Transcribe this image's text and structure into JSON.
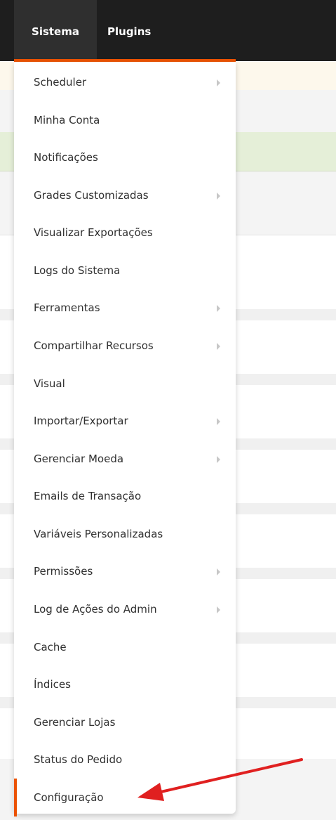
{
  "topnav": {
    "tabs": [
      {
        "label": "Sistema",
        "active": true
      },
      {
        "label": "Plugins",
        "active": false
      }
    ]
  },
  "menu": {
    "items": [
      {
        "label": "Scheduler",
        "submenu": true
      },
      {
        "label": "Minha Conta",
        "submenu": false
      },
      {
        "label": "Notificações",
        "submenu": false
      },
      {
        "label": "Grades Customizadas",
        "submenu": true
      },
      {
        "label": "Visualizar Exportações",
        "submenu": false
      },
      {
        "label": "Logs do Sistema",
        "submenu": false
      },
      {
        "label": "Ferramentas",
        "submenu": true
      },
      {
        "label": "Compartilhar Recursos",
        "submenu": true
      },
      {
        "label": "Visual",
        "submenu": false
      },
      {
        "label": "Importar/Exportar",
        "submenu": true
      },
      {
        "label": "Gerenciar Moeda",
        "submenu": true
      },
      {
        "label": "Emails de Transação",
        "submenu": false
      },
      {
        "label": "Variáveis Personalizadas",
        "submenu": false
      },
      {
        "label": "Permissões",
        "submenu": true
      },
      {
        "label": "Log de Ações do Admin",
        "submenu": true
      },
      {
        "label": "Cache",
        "submenu": false
      },
      {
        "label": "Índices",
        "submenu": false
      },
      {
        "label": "Gerenciar Lojas",
        "submenu": false
      },
      {
        "label": "Status do Pedido",
        "submenu": false
      },
      {
        "label": "Configuração",
        "submenu": false,
        "active": true
      }
    ]
  },
  "colors": {
    "accent": "#eb5202",
    "nav_bg": "#1e1e1e",
    "arrow": "#e02020"
  }
}
